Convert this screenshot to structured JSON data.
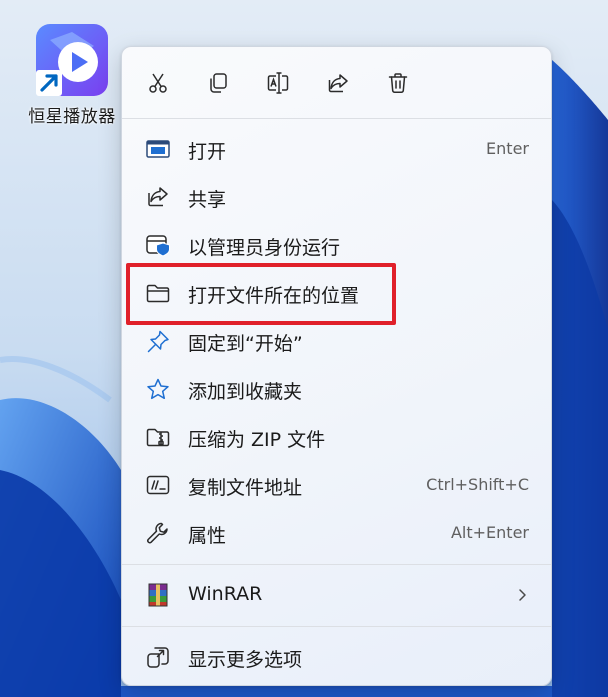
{
  "desktop_icon": {
    "label": "恒星播放器",
    "icon": "play-logo-icon"
  },
  "toolbar": {
    "cut_icon": "scissors-icon",
    "copy_icon": "copy-icon",
    "rename_icon": "rename-icon",
    "share_icon": "share-icon",
    "delete_icon": "trash-icon"
  },
  "menu": {
    "items": [
      {
        "label": "打开",
        "shortcut": "Enter",
        "icon": "open-window-icon"
      },
      {
        "label": "共享",
        "shortcut": "",
        "icon": "share-icon"
      },
      {
        "label": "以管理员身份运行",
        "shortcut": "",
        "icon": "shield-icon"
      },
      {
        "label": "打开文件所在的位置",
        "shortcut": "",
        "icon": "folder-icon"
      },
      {
        "label": "固定到“开始”",
        "shortcut": "",
        "icon": "pin-icon"
      },
      {
        "label": "添加到收藏夹",
        "shortcut": "",
        "icon": "star-icon"
      },
      {
        "label": "压缩为 ZIP 文件",
        "shortcut": "",
        "icon": "zip-folder-icon"
      },
      {
        "label": "复制文件地址",
        "shortcut": "Ctrl+Shift+C",
        "icon": "copy-path-icon"
      },
      {
        "label": "属性",
        "shortcut": "Alt+Enter",
        "icon": "wrench-icon"
      },
      {
        "label": "WinRAR",
        "shortcut": "",
        "icon": "winrar-icon",
        "submenu": true
      },
      {
        "label": "显示更多选项",
        "shortcut": "",
        "icon": "more-options-icon"
      }
    ]
  },
  "colors": {
    "highlight": "#e0202a",
    "accent": "#0067c0",
    "logo": "#3b6cf0"
  }
}
